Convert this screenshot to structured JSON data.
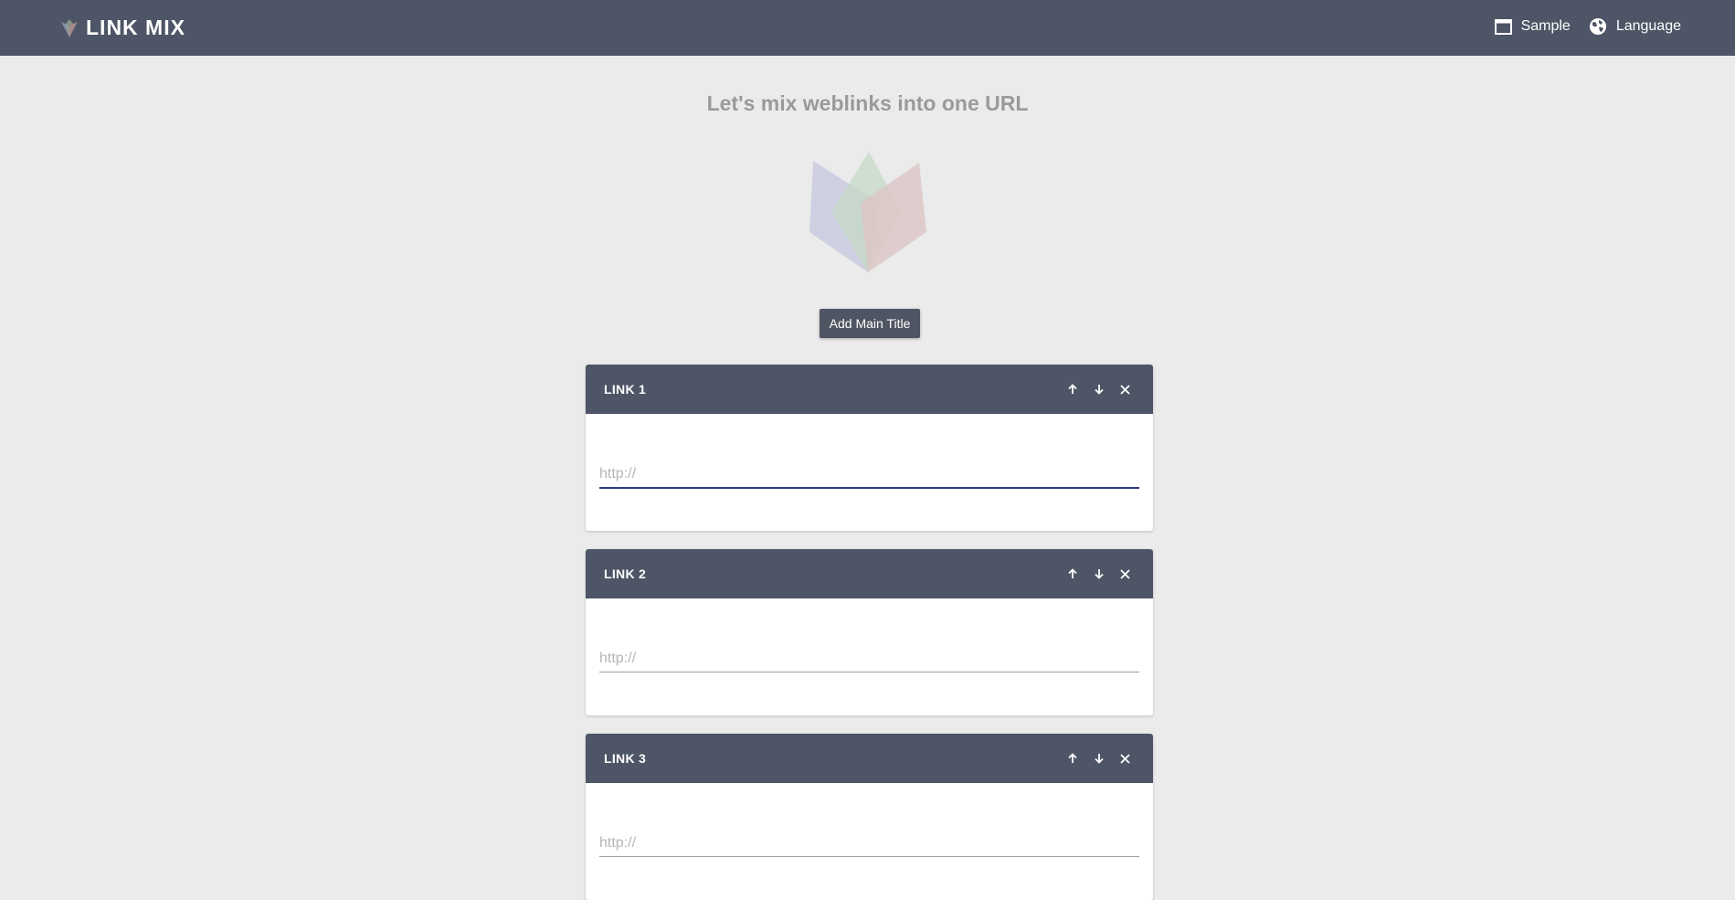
{
  "header": {
    "brand": "LINK MIX",
    "nav": [
      {
        "label": "Sample",
        "icon": "window-icon"
      },
      {
        "label": "Language",
        "icon": "globe-icon"
      }
    ]
  },
  "main": {
    "heading": "Let's mix weblinks into one URL",
    "add_title_label": "Add Main Title"
  },
  "links": [
    {
      "title": "LINK 1",
      "placeholder": "http://",
      "value": "",
      "focused": true
    },
    {
      "title": "LINK 2",
      "placeholder": "http://",
      "value": "",
      "focused": false
    },
    {
      "title": "LINK 3",
      "placeholder": "http://",
      "value": "",
      "focused": false
    }
  ],
  "colors": {
    "topbar": "#4d5566",
    "background": "#ebebeb",
    "focus_underline": "#2b3a8c"
  }
}
